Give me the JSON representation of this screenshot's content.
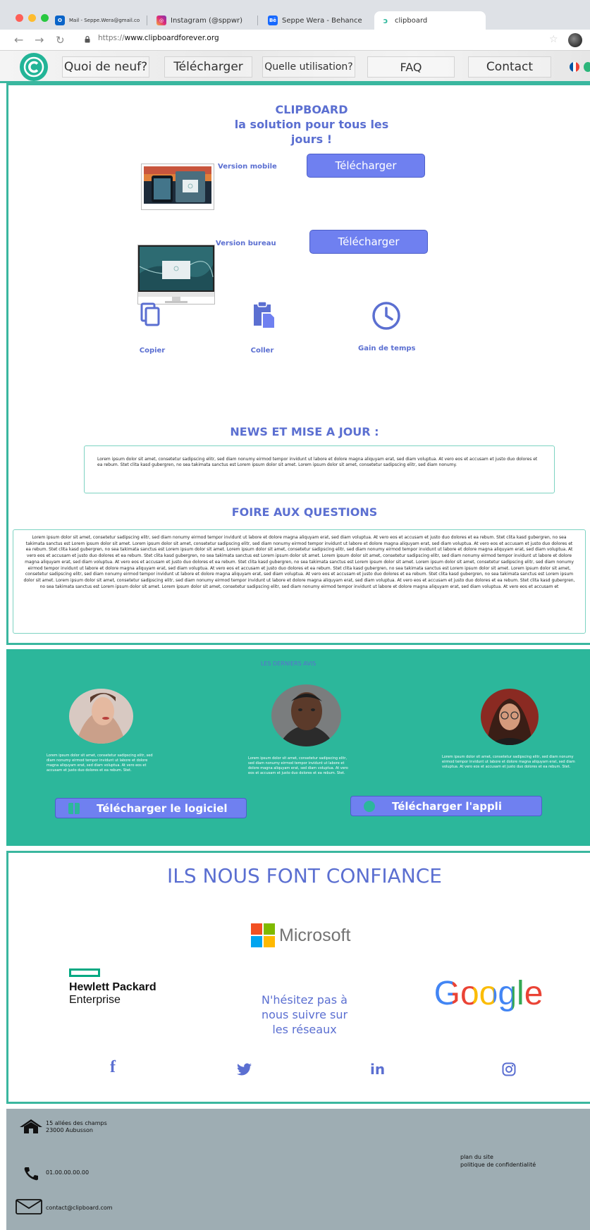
{
  "browser": {
    "tabs": [
      {
        "label": "Mail - Seppe.Wera@gmail.com",
        "icon": "outlook-icon"
      },
      {
        "label": "Instagram (@sppwr)",
        "icon": "instagram-icon"
      },
      {
        "label": "Seppe Wera - Behance",
        "icon": "behance-icon"
      },
      {
        "label": "clipboard",
        "icon": "clipboard-tab-icon"
      }
    ],
    "url_scheme": "https://",
    "url_host": "www.clipboardforever.org"
  },
  "nav": {
    "items": [
      "Quoi de neuf?",
      "Télécharger",
      "Quelle utilisation?",
      "FAQ",
      "Contact"
    ]
  },
  "hero": {
    "title_line1": "CLIPBOARD",
    "title_line2": "la solution pour tous les",
    "title_line3": "jours !"
  },
  "versions": [
    {
      "label": "Version mobile",
      "button": "Télécharger"
    },
    {
      "label": "Version bureau",
      "button": "Télécharger"
    }
  ],
  "features": [
    "Copier",
    "Coller",
    "Gain de temps"
  ],
  "news": {
    "title": "NEWS ET MISE A JOUR :",
    "body": "Lorem ipsum dolor sit amet, consetetur sadipscing elitr, sed diam nonumy eirmod tempor invidunt ut labore et dolore magna aliquyam erat, sed diam voluptua. At vero eos et accusam et justo duo dolores et ea rebum. Stet clita kasd gubergren, no sea takimata sanctus est Lorem ipsum dolor sit amet. Lorem ipsum dolor sit amet, consetetur sadipscing elitr, sed diam nonumy."
  },
  "faq": {
    "title": "FOIRE AUX QUESTIONS",
    "body": "Lorem ipsum dolor sit amet, consetetur sadipscing elitr, sed diam nonumy eirmod tempor invidunt ut labore et dolore magna aliquyam erat, sed diam voluptua. At vero eos et accusam et justo duo dolores et ea rebum. Stet clita kasd gubergren, no sea takimata sanctus est Lorem ipsum dolor sit amet. Lorem ipsum dolor sit amet, consetetur sadipscing elitr, sed diam nonumy eirmod tempor invidunt ut labore et dolore magna aliquyam erat, sed diam voluptua. At vero eos et accusam et justo duo dolores et ea rebum. Stet clita kasd gubergren, no sea takimata sanctus est Lorem ipsum dolor sit amet. Lorem ipsum dolor sit amet, consetetur sadipscing elitr, sed diam nonumy eirmod tempor invidunt ut labore et dolore magna aliquyam erat, sed diam voluptua. At vero eos et accusam et justo duo dolores et ea rebum. Stet clita kasd gubergren, no sea takimata sanctus est Lorem ipsum dolor sit amet. Lorem ipsum dolor sit amet, consetetur sadipscing elitr, sed diam nonumy eirmod tempor invidunt ut labore et dolore magna aliquyam erat, sed diam voluptua. At vero eos et accusam et justo duo dolores et ea rebum. Stet clita kasd gubergren, no sea takimata sanctus est Lorem ipsum dolor sit amet. Lorem ipsum dolor sit amet, consetetur sadipscing elitr, sed diam nonumy eirmod tempor invidunt ut labore et dolore magna aliquyam erat, sed diam voluptua. At vero eos et accusam et justo duo dolores et ea rebum. Stet clita kasd gubergren, no sea takimata sanctus est Lorem ipsum dolor sit amet. Lorem ipsum dolor sit amet, consetetur sadipscing elitr, sed diam nonumy eirmod tempor invidunt ut labore et dolore magna aliquyam erat, sed diam voluptua. At vero eos et accusam et justo duo dolores et ea rebum. Stet clita kasd gubergren, no sea takimata sanctus est Lorem ipsum dolor sit amet. Lorem ipsum dolor sit amet, consetetur sadipscing elitr, sed diam nonumy eirmod tempor invidunt ut labore et dolore magna aliquyam erat, sed diam voluptua. At vero eos et accusam et justo duo dolores et ea rebum. Stet clita kasd gubergren, no sea takimata sanctus est Lorem ipsum dolor sit amet. Lorem ipsum dolor sit amet, consetetur sadipscing elitr, sed diam nonumy eirmod tempor invidunt ut labore et dolore magna aliquyam erat, sed diam voluptua. At vero eos et accusam et"
  },
  "reviews": {
    "title": "LES DERNIERS AVIS",
    "items": [
      "Lorem ipsum dolor sit amet, consetetur sadipscing elitr, sed diam nonumy eirmod tempor invidunt ut labore et dolore magna aliquyam erat, sed diam voluptua. At vero eos et accusam et justo duo dolores et ea rebum. Stet.",
      "Lorem ipsum dolor sit amet, consetetur sadipscing elitr, sed diam nonumy eirmod tempor invidunt ut labore et dolore magna aliquyam erat, sed diam voluptua. At vero eos et accusam et justo duo dolores et ea rebum. Stet.",
      "Lorem ipsum dolor sit amet, consetetur sadipscing elitr, sed diam nonumy eirmod tempor invidunt ut labore et dolore magna aliquyam erat, sed diam voluptua. At vero eos et accusam et justo duo dolores et ea rebum. Stet."
    ],
    "button_software": "Télécharger le logiciel",
    "button_app": "Télécharger l'appli"
  },
  "trust": {
    "title": "ILS NOUS FONT CONFIANCE",
    "microsoft": "Microsoft",
    "hpe_line1": "Hewlett Packard",
    "hpe_line2": "Enterprise",
    "google": "Google",
    "follow_line1": "N'hésitez pas à",
    "follow_line2": "nous suivre sur",
    "follow_line3": "les réseaux",
    "social": {
      "facebook": "f",
      "linkedin": "in"
    }
  },
  "footer": {
    "address_line1": "15 allées des champs",
    "address_line2": "23000 Aubusson",
    "phone": "01.00.00.00.00",
    "email": "contact@clipboard.com",
    "sitemap": "plan du site",
    "privacy": "politique de confidentialité"
  },
  "colors": {
    "teal": "#2cb79b",
    "blue": "#5b6fd1",
    "button": "#6f80f0",
    "footer": "#9eadb3"
  }
}
